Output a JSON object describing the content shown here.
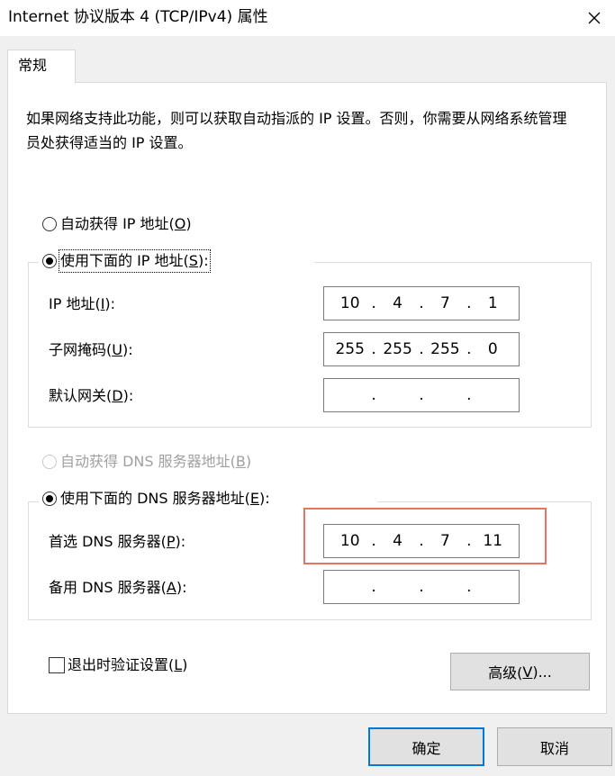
{
  "window": {
    "title": "Internet 协议版本 4 (TCP/IPv4) 属性"
  },
  "tabs": [
    {
      "label": "常规",
      "selected": true
    }
  ],
  "general": {
    "description": "如果网络支持此功能，则可以获取自动指派的 IP 设置。否则，你需要从网络系统管理员处获得适当的 IP 设置。",
    "ip_auto": {
      "label": "自动获得 IP 地址(",
      "key": "O",
      "suffix": ")",
      "checked": false
    },
    "ip_manual": {
      "label": "使用下面的 IP 地址(",
      "key": "S",
      "suffix": "):",
      "checked": true
    },
    "ip_address": {
      "label": "IP 地址(",
      "key": "I",
      "suffix": "):",
      "octets": [
        "10",
        "4",
        "7",
        "1"
      ]
    },
    "subnet_mask": {
      "label": "子网掩码(",
      "key": "U",
      "suffix": "):",
      "octets": [
        "255",
        "255",
        "255",
        "0"
      ]
    },
    "gateway": {
      "label": "默认网关(",
      "key": "D",
      "suffix": "):",
      "octets": [
        "",
        "",
        "",
        ""
      ]
    },
    "dns_auto": {
      "label": "自动获得 DNS 服务器地址(",
      "key": "B",
      "suffix": ")",
      "checked": false,
      "disabled": true
    },
    "dns_manual": {
      "label": "使用下面的 DNS 服务器地址(",
      "key": "E",
      "suffix": "):",
      "checked": true
    },
    "preferred_dns": {
      "label": "首选 DNS 服务器(",
      "key": "P",
      "suffix": "):",
      "octets": [
        "10",
        "4",
        "7",
        "11"
      ]
    },
    "alternate_dns": {
      "label": "备用 DNS 服务器(",
      "key": "A",
      "suffix": "):",
      "octets": [
        "",
        "",
        "",
        ""
      ]
    },
    "validate_on_exit": {
      "label": "退出时验证设置(",
      "key": "L",
      "suffix": ")",
      "checked": false
    },
    "advanced_button": {
      "label": "高级(",
      "key": "V",
      "suffix": ")..."
    }
  },
  "footer": {
    "ok_label": "确定",
    "cancel_label": "取消"
  },
  "colors": {
    "highlight_border": "#e9735d",
    "default_button_border": "#0078d7"
  },
  "icons": {
    "close": "close-icon"
  }
}
